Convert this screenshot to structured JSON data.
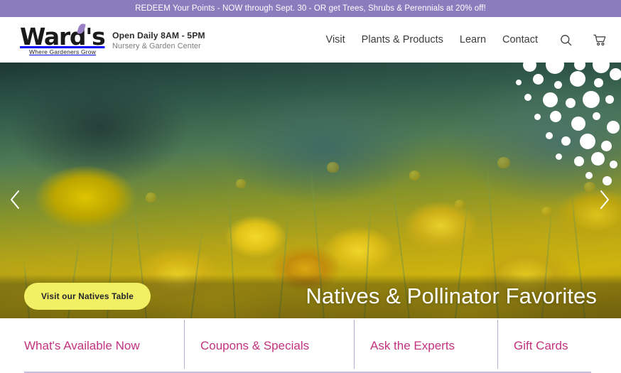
{
  "promo": {
    "text": "REDEEM Your Points - NOW through Sept. 30 - OR get Trees, Shrubs & Perennials at 20% off!",
    "background": "#8B7CBE"
  },
  "header": {
    "logo": {
      "wordmark": "Ward's",
      "tagline": "Where Gardeners Grow",
      "leaf_icon": "leaf-icon",
      "leaf_color": "#9B7FC4"
    },
    "hours": {
      "primary": "Open Daily 8AM - 5PM",
      "secondary": "Nursery & Garden Center"
    },
    "nav": [
      {
        "label": "Visit"
      },
      {
        "label": "Plants & Products"
      },
      {
        "label": "Learn"
      },
      {
        "label": "Contact"
      }
    ],
    "icons": {
      "search": "search-icon",
      "cart": "shopping-cart-icon"
    }
  },
  "hero": {
    "title": "Natives & Pollinator Favorites",
    "cta_label": "Visit our Natives Table",
    "cta_color": "#F1EF63",
    "prev_label": "Previous slide",
    "next_label": "Next slide",
    "image_description": "Close-up of yellow coreopsis wildflowers with a bee"
  },
  "quick_links": {
    "accent_color": "#C3327F",
    "items": [
      {
        "label": "What's Available Now"
      },
      {
        "label": "Coupons & Specials"
      },
      {
        "label": "Ask the Experts"
      },
      {
        "label": "Gift Cards"
      }
    ]
  }
}
